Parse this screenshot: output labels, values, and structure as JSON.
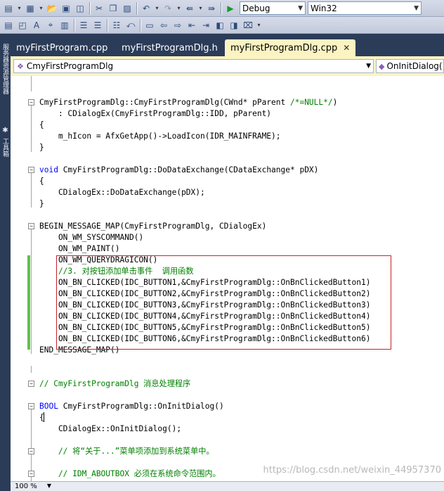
{
  "toolbar": {
    "config_value": "Debug",
    "platform_value": "Win32"
  },
  "dock": {
    "labels": [
      "服务器资源管理器",
      "工具箱"
    ]
  },
  "tabs": [
    {
      "label": "myFirstProgram.cpp"
    },
    {
      "label": "myFirstProgramDlg.h"
    },
    {
      "label": "myFirstProgramDlg.cpp"
    }
  ],
  "navbar": {
    "class_value": "CmyFirstProgramDlg",
    "member_value": "OnInitDialog()"
  },
  "code": {
    "ctor_sig": "CmyFirstProgramDlg::CmyFirstProgramDlg(CWnd* pParent ",
    "ctor_sig_comment": "/*=NULL*/",
    "ctor_sig_end": ")",
    "ctor_init": "    : CDialogEx(CmyFirstProgramDlg::IDD, pParent)",
    "brace_open": "{",
    "icon_line": "    m_hIcon = AfxGetApp()->LoadIcon(IDR_MAINFRAME);",
    "brace_close": "}",
    "void_kw": "void",
    "dde_sig": " CmyFirstProgramDlg::DoDataExchange(CDataExchange* pDX)",
    "dde_body": "    CDialogEx::DoDataExchange(pDX);",
    "begin_map": "BEGIN_MESSAGE_MAP(CmyFirstProgramDlg, CDialogEx)",
    "syscommand": "    ON_WM_SYSCOMMAND()",
    "paint": "    ON_WM_PAINT()",
    "querydragicon": "    ON_WM_QUERYDRAGICON()",
    "comment_3": "    //3. 对按钮添加单击事件  调用函数",
    "clicked_1": "    ON_BN_CLICKED(IDC_BUTTON1,&CmyFirstProgramDlg::OnBnClickedButton1)",
    "clicked_2": "    ON_BN_CLICKED(IDC_BUTTON2,&CmyFirstProgramDlg::OnBnClickedButton2)",
    "clicked_3": "    ON_BN_CLICKED(IDC_BUTTON3,&CmyFirstProgramDlg::OnBnClickedButton3)",
    "clicked_4": "    ON_BN_CLICKED(IDC_BUTTON4,&CmyFirstProgramDlg::OnBnClickedButton4)",
    "clicked_5": "    ON_BN_CLICKED(IDC_BUTTON5,&CmyFirstProgramDlg::OnBnClickedButton5)",
    "clicked_6": "    ON_BN_CLICKED(IDC_BUTTON6,&CmyFirstProgramDlg::OnBnClickedButton6)",
    "end_map": "END_MESSAGE_MAP()",
    "handler_comment": "// CmyFirstProgramDlg 消息处理程序",
    "bool_kw": "BOOL",
    "init_sig": " CmyFirstProgramDlg::OnInitDialog()",
    "init_base": "    CDialogEx::OnInitDialog();",
    "about_comment": "    // 将“关于...”菜单项添加到系统菜单中。",
    "idm_comment": "    // IDM_ABOUTBOX 必须在系统命令范围内。"
  },
  "status": {
    "zoom": "100 %"
  },
  "watermark": "https://blog.csdn.net/weixin_44957370"
}
